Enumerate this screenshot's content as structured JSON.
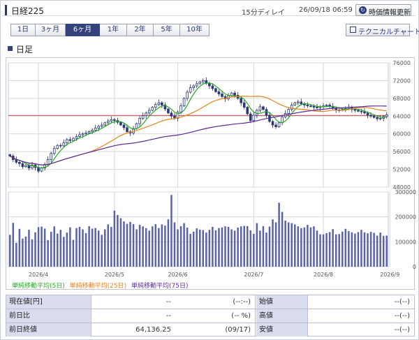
{
  "header": {
    "title": "日経225",
    "delay": "15分ディレイ",
    "timestamp": "26/09/18 06:59",
    "refresh_label": "時価情報更新"
  },
  "tabs": [
    {
      "label": "1日",
      "active": false
    },
    {
      "label": "3ヶ月",
      "active": false
    },
    {
      "label": "6ヶ月",
      "active": true
    },
    {
      "label": "1年",
      "active": false
    },
    {
      "label": "2年",
      "active": false
    },
    {
      "label": "5年",
      "active": false
    },
    {
      "label": "10年",
      "active": false
    }
  ],
  "technical_chart_label": "テクニカルチャート",
  "section_title": "日足",
  "legend": [
    {
      "label": "単純移動平均(5日)",
      "color": "#22aa22"
    },
    {
      "label": "単純移動平均(25日)",
      "color": "#e8831a"
    },
    {
      "label": "単純移動平均(75日)",
      "color": "#5a2a9a"
    }
  ],
  "colors": {
    "up_candle": "#2a3a7a",
    "down_candle": "#2a3a7a",
    "volume_bar": "#5b63a8",
    "reference_line": "#d2454f",
    "grid": "#d8d8d8",
    "label_bg": "#d9ddef"
  },
  "chart_data": {
    "type": "candlestick",
    "title": "",
    "price_axis": {
      "min": 48000,
      "max": 76000,
      "ticks": [
        48000,
        52000,
        56000,
        60000,
        64000,
        68000,
        72000,
        76000
      ]
    },
    "volume_axis": {
      "min": 0,
      "max": 300000,
      "ticks": [
        0,
        100000,
        200000,
        300000
      ]
    },
    "x_labels": [
      "2026/4",
      "2026/5",
      "2026/6",
      "2026/7",
      "2026/8",
      "2026/9"
    ],
    "x_label_index": [
      9,
      33,
      53,
      77,
      99,
      120
    ],
    "reference_line": 64136.25,
    "close": [
      55000,
      54200,
      53600,
      53300,
      52600,
      52900,
      52300,
      53000,
      52400,
      51600,
      52300,
      53100,
      54200,
      55600,
      56700,
      57400,
      57300,
      58000,
      58700,
      58500,
      59000,
      59400,
      59800,
      60000,
      60200,
      60500,
      60800,
      61300,
      61700,
      62000,
      62500,
      62900,
      63200,
      63000,
      62600,
      62000,
      61400,
      60500,
      60200,
      61200,
      62300,
      63500,
      64100,
      64700,
      65300,
      66000,
      66600,
      67000,
      66500,
      65600,
      64700,
      64000,
      63500,
      64900,
      66300,
      68000,
      69400,
      70400,
      70800,
      71300,
      71700,
      72000,
      71400,
      70800,
      70200,
      69500,
      69000,
      68400,
      67900,
      68600,
      69200,
      68700,
      68000,
      67000,
      66000,
      64500,
      63000,
      64200,
      65300,
      66100,
      65500,
      64200,
      62800,
      62000,
      61600,
      62500,
      63800,
      64600,
      65500,
      66500,
      67000,
      67200,
      66800,
      66500,
      66300,
      66200,
      66000,
      65900,
      66100,
      66300,
      66500,
      66200,
      65800,
      65400,
      65300,
      65500,
      65700,
      66000,
      65500,
      65300,
      65100,
      65000,
      64700,
      64200,
      64000,
      63700,
      63400,
      63500,
      63900,
      64300
    ],
    "volume": [
      128000,
      176000,
      96000,
      152000,
      113000,
      121000,
      148000,
      110000,
      138000,
      159000,
      161000,
      153000,
      107000,
      140000,
      162000,
      133000,
      148000,
      120000,
      137000,
      158000,
      108000,
      155000,
      160000,
      150000,
      135000,
      163000,
      153000,
      155000,
      145000,
      128000,
      150000,
      170000,
      160000,
      225000,
      208000,
      195000,
      182000,
      172000,
      180000,
      171000,
      150000,
      168000,
      162000,
      155000,
      145000,
      162000,
      171000,
      155000,
      170000,
      165000,
      190000,
      288000,
      178000,
      150000,
      163000,
      175000,
      157000,
      132000,
      141000,
      154000,
      149000,
      147000,
      137000,
      148000,
      160000,
      146000,
      155000,
      158000,
      162000,
      160000,
      150000,
      145000,
      157000,
      162000,
      164000,
      163000,
      146000,
      132000,
      175000,
      145000,
      163000,
      137000,
      161000,
      190000,
      178000,
      257000,
      220000,
      185000,
      178000,
      175000,
      170000,
      162000,
      155000,
      158000,
      168000,
      158000,
      162000,
      145000,
      130000,
      130000,
      135000,
      139000,
      151000,
      130000,
      131000,
      141000,
      152000,
      143000,
      138000,
      133000,
      139000,
      148000,
      138000,
      134000,
      140000,
      136000,
      125000,
      137000,
      124000,
      125000
    ]
  },
  "table": [
    {
      "label": "現在値[円]",
      "value": "--",
      "sub": "(--:--)",
      "label2": "始値",
      "value2": "--(--)"
    },
    {
      "label": "前日比",
      "value": "--",
      "sub": "(-- %)",
      "label2": "高値",
      "value2": "--(--)"
    },
    {
      "label": "前日終値",
      "value": "64,136.25",
      "sub": "(09/17)",
      "label2": "安値",
      "value2": "--(--)"
    }
  ]
}
